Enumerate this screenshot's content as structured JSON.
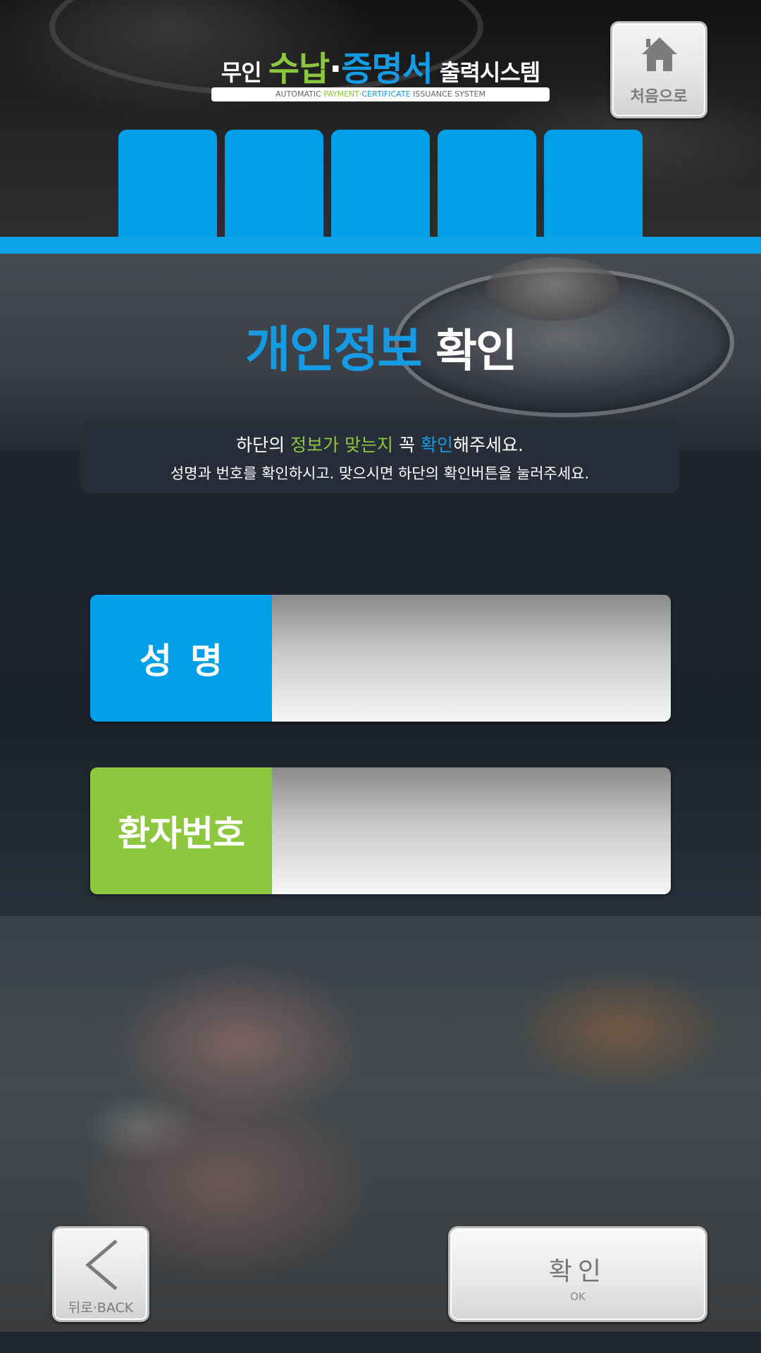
{
  "header": {
    "title_prefix": "무인 ",
    "title_accent1": "수납",
    "title_dot": "·",
    "title_accent2": "증명서",
    "title_suffix": " 출력시스템",
    "subtitle_part1": "AUTOMATIC ",
    "subtitle_part2": "PAYMENT",
    "subtitle_part3": "·",
    "subtitle_part4": "CERTIFICATE",
    "subtitle_part5": " ISSUANCE SYSTEM",
    "home_label": "처음으로"
  },
  "steps": {
    "tabs": [
      "",
      "",
      "",
      "",
      ""
    ]
  },
  "page": {
    "title_accent": "개인정보",
    "title_rest": " 확인",
    "notice_line1_a": "하단의 ",
    "notice_line1_b": "정보가 맞는지",
    "notice_line1_c": " 꼭 ",
    "notice_line1_d": "확인",
    "notice_line1_e": "해주세요.",
    "notice_line2": "성명과 번호를 확인하시고. 맞으시면 하단의 확인버튼을 눌러주세요."
  },
  "fields": {
    "name_label": "성명",
    "name_value": "",
    "patient_label": "환자번호",
    "patient_value": ""
  },
  "footer": {
    "back_label": "뒤로·BACK",
    "ok_label": "확인",
    "ok_sub": "OK"
  },
  "colors": {
    "accent_blue": "#009fe8",
    "accent_green": "#8dc63f"
  }
}
